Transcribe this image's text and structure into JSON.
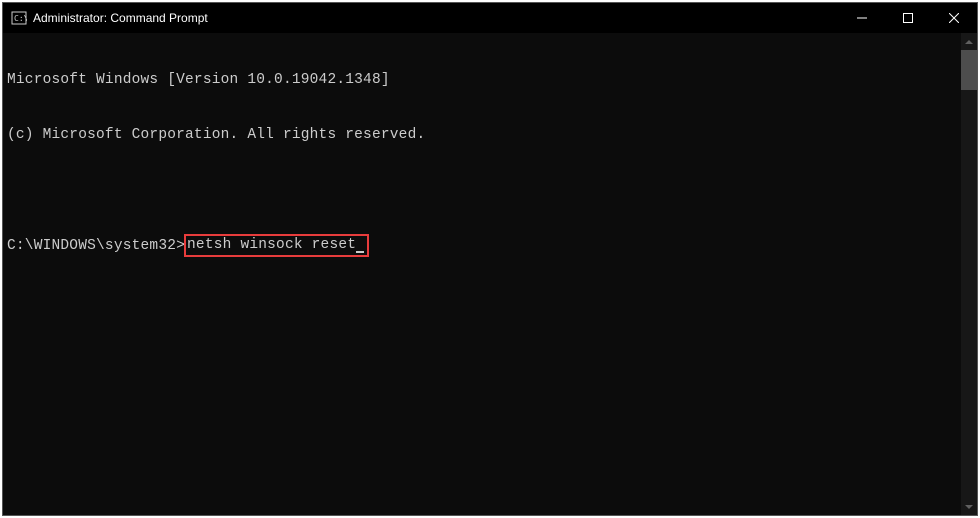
{
  "window": {
    "title": "Administrator: Command Prompt"
  },
  "terminal": {
    "line1": "Microsoft Windows [Version 10.0.19042.1348]",
    "line2": "(c) Microsoft Corporation. All rights reserved.",
    "prompt": "C:\\WINDOWS\\system32>",
    "command": "netsh winsock reset"
  },
  "icons": {
    "app": "cmd-icon",
    "minimize": "minimize-icon",
    "maximize": "maximize-icon",
    "close": "close-icon",
    "scrollUp": "scroll-up-icon",
    "scrollDown": "scroll-down-icon"
  }
}
